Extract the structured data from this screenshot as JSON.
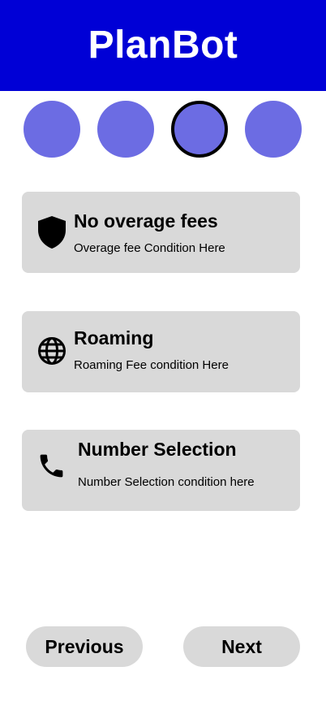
{
  "header": {
    "title": "PlanBot",
    "background_color": "#0000d6"
  },
  "steps": {
    "count": 4,
    "active_index": 2,
    "dot_color": "#6c6ce3"
  },
  "features": [
    {
      "icon": "shield-icon",
      "title": "No overage fees",
      "description": "Overage fee Condition Here"
    },
    {
      "icon": "globe-icon",
      "title": "Roaming",
      "description": "Roaming Fee condition Here"
    },
    {
      "icon": "phone-icon",
      "title": "Number Selection",
      "description": "Number Selection condition here"
    }
  ],
  "navigation": {
    "previous_label": "Previous",
    "next_label": "Next"
  }
}
